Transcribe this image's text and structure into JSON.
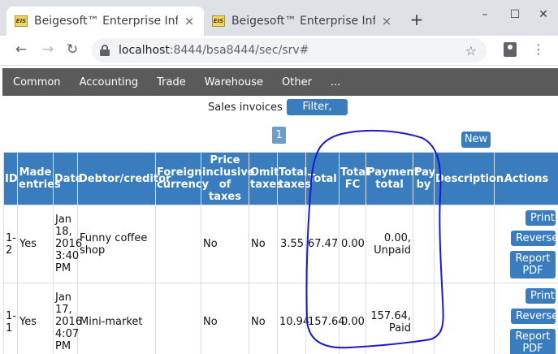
{
  "browser": {
    "tabs": [
      {
        "favicon": "EIS",
        "title": "Beigesoft™ Enterprise Info",
        "close": "×"
      },
      {
        "favicon": "EIS",
        "title": "Beigesoft™ Enterprise Info",
        "close": "×"
      }
    ],
    "new_tab": "+",
    "window_controls": {
      "minimize": "–",
      "maximize": "☐",
      "close": "✕"
    },
    "nav": {
      "back": "←",
      "forward": "→",
      "reload": "↻"
    },
    "url_host": "localhost",
    "url_rest": ":8444/bsa8444/sec/srv#",
    "star": "☆",
    "menu": "⋮"
  },
  "appnav": [
    "Common",
    "Accounting",
    "Trade",
    "Warehouse",
    "Other",
    "..."
  ],
  "page": {
    "title": "Sales invoices",
    "filter_button": "Filter, order",
    "page_number": "1",
    "new_button": "New"
  },
  "table": {
    "headers": [
      "ID",
      "Made entries",
      "Date",
      "Debtor/creditor",
      "Foreign currency",
      "Price inclusive of taxes",
      "Omit taxes",
      "Total taxes",
      "Total",
      "Total FC",
      "Payment total",
      "Pay by",
      "Description",
      "Actions"
    ],
    "rows": [
      {
        "id": "1-2",
        "made_entries": "Yes",
        "date": "Jan 18, 2016 3:40 PM",
        "debtor": "Funny coffee shop",
        "foreign_currency": "",
        "price_incl_taxes": "No",
        "omit_taxes": "No",
        "total_taxes": "3.55",
        "total": "67.47",
        "total_fc": "0.00",
        "payment_total": "0.00, Unpaid",
        "pay_by": "",
        "description": ""
      },
      {
        "id": "1-1",
        "made_entries": "Yes",
        "date": "Jan 17, 2016 4:07 PM",
        "debtor": "Mini-market",
        "foreign_currency": "",
        "price_incl_taxes": "No",
        "omit_taxes": "No",
        "total_taxes": "10.94",
        "total": "157.64",
        "total_fc": "0.00",
        "payment_total": "157.64, Paid",
        "pay_by": "",
        "description": ""
      }
    ],
    "actions": {
      "print": "Print",
      "reverse": "Reverse",
      "pdf": "Report PDF"
    }
  },
  "colors": {
    "primary": "#3a7dbf",
    "nav_bg": "#5a5a5a",
    "annotation": "#1a1acc"
  }
}
